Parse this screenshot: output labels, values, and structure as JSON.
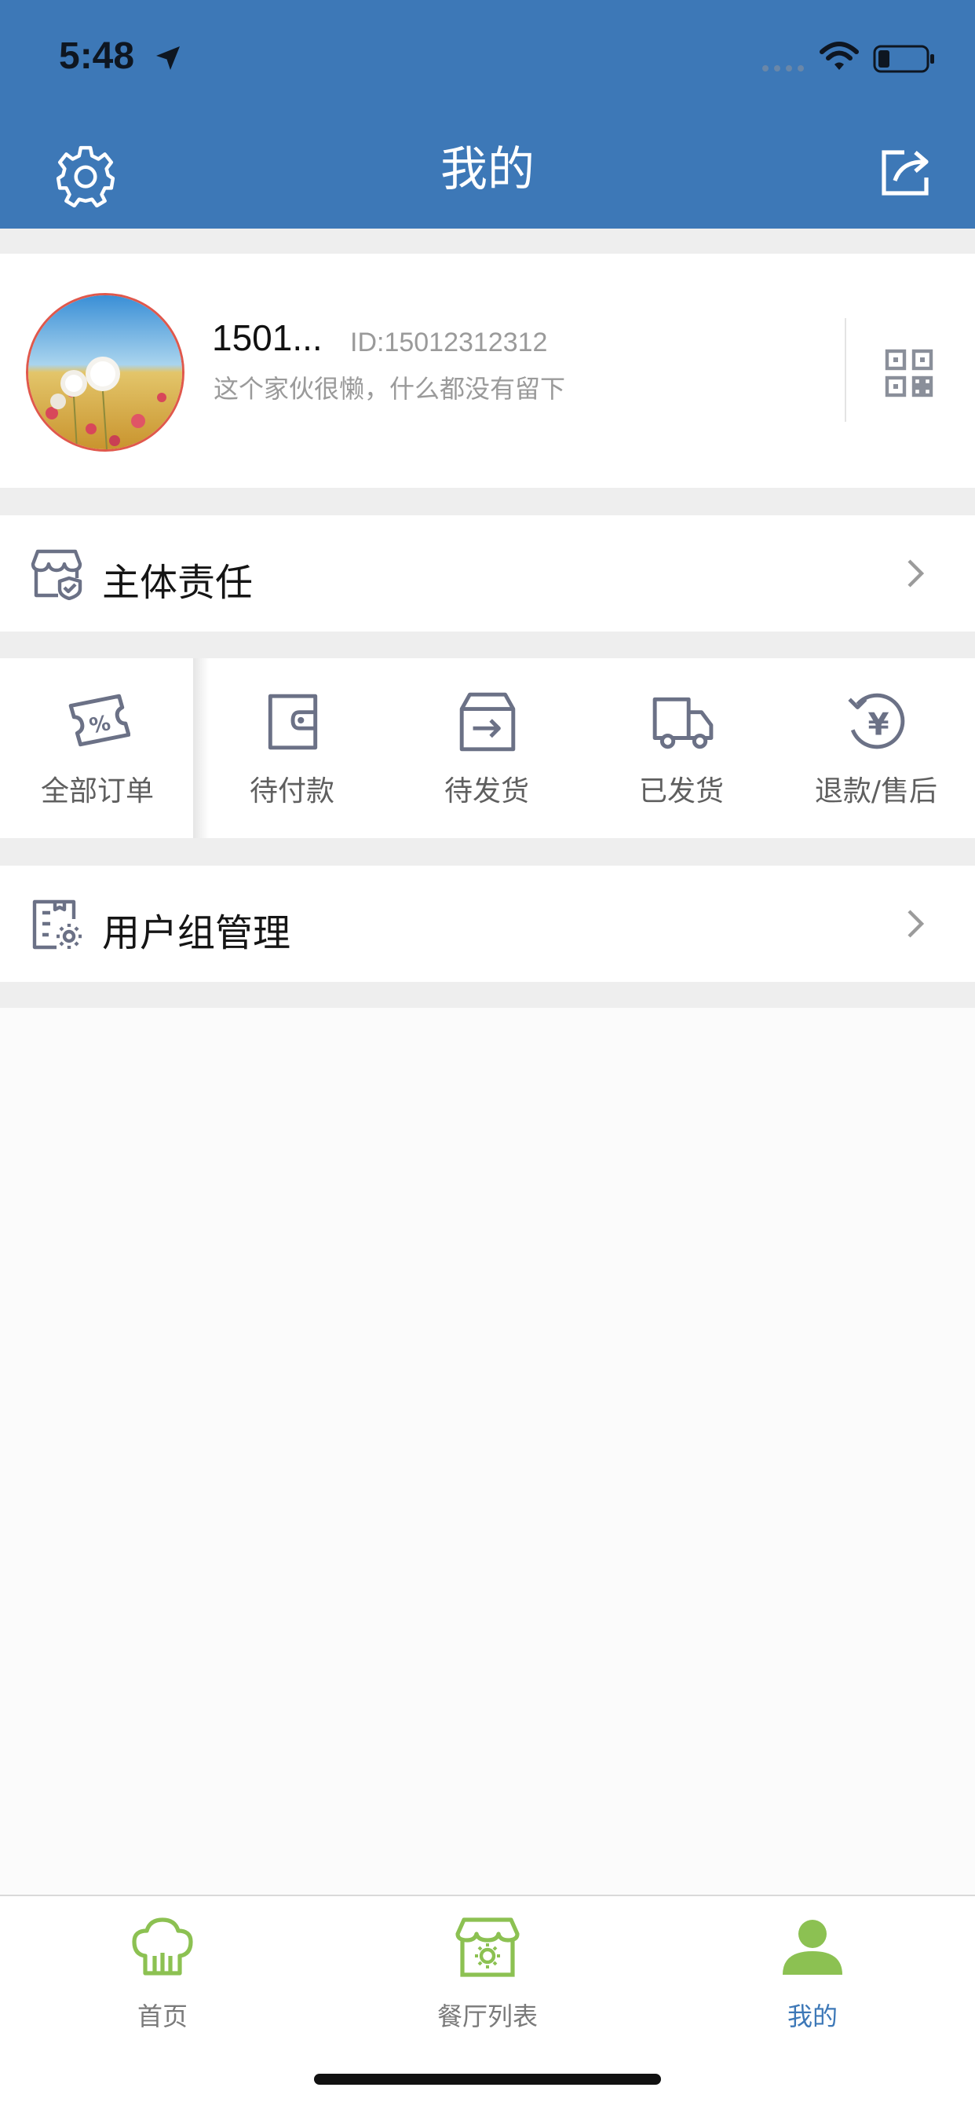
{
  "status_bar": {
    "time": "5:48"
  },
  "header": {
    "title": "我的"
  },
  "profile": {
    "name": "1501...",
    "id": "ID:15012312312",
    "bio": "这个家伙很懒，什么都没有留下"
  },
  "responsibility": {
    "label": "主体责任"
  },
  "orders": [
    {
      "label": "全部订单",
      "icon": "coupon-percent-icon"
    },
    {
      "label": "待付款",
      "icon": "wallet-icon"
    },
    {
      "label": "待发货",
      "icon": "box-arrow-icon"
    },
    {
      "label": "已发货",
      "icon": "truck-icon"
    },
    {
      "label": "退款/售后",
      "icon": "refund-yen-icon"
    }
  ],
  "user_group": {
    "label": "用户组管理"
  },
  "tabbar": {
    "items": [
      {
        "label": "首页",
        "icon": "chef-hat-icon"
      },
      {
        "label": "餐厅列表",
        "icon": "restaurant-icon"
      },
      {
        "label": "我的",
        "icon": "person-icon"
      }
    ],
    "active_index": 2
  },
  "colors": {
    "header_bg": "#3d78b7",
    "tab_active": "#3d78b7",
    "tab_icon_green": "#8cc152",
    "line_icon": "#6b7186"
  }
}
